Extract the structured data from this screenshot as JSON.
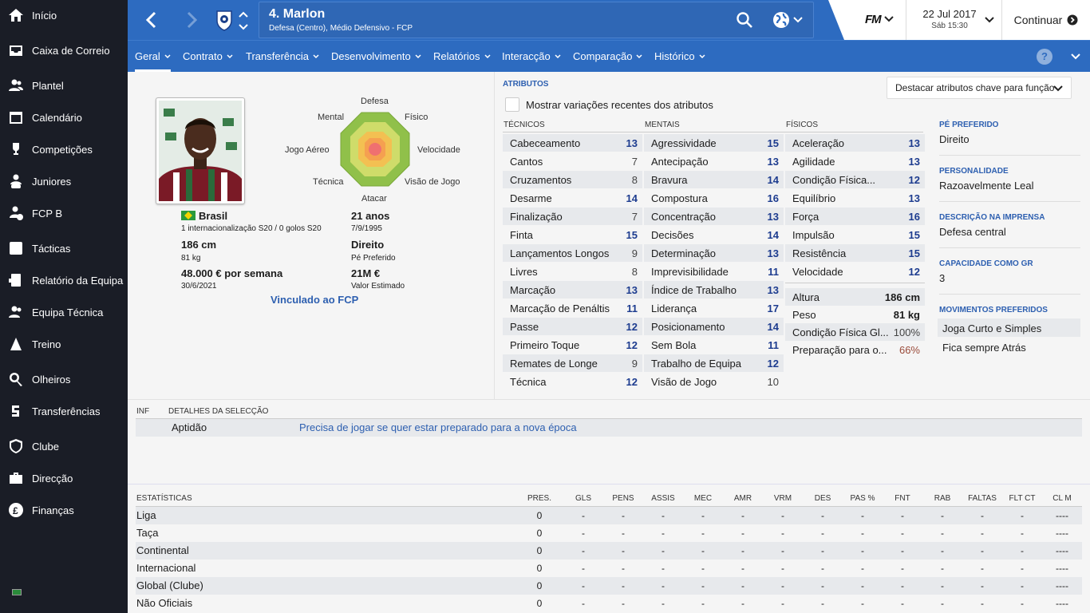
{
  "sidebar": {
    "items": [
      {
        "label": "Início",
        "icon": "home-icon"
      },
      {
        "label": "Caixa de Correio",
        "icon": "inbox-icon"
      },
      {
        "label": "Plantel",
        "icon": "squad-icon"
      },
      {
        "label": "Calendário",
        "icon": "calendar-icon"
      },
      {
        "label": "Competições",
        "icon": "trophy-icon"
      },
      {
        "label": "Juniores",
        "icon": "juniors-icon"
      },
      {
        "label": "FCP B",
        "icon": "b-team-icon"
      },
      {
        "label": "Tácticas",
        "icon": "tactics-icon"
      },
      {
        "label": "Relatório da Equipa",
        "icon": "report-icon"
      },
      {
        "label": "Equipa Técnica",
        "icon": "staff-icon"
      },
      {
        "label": "Treino",
        "icon": "training-icon"
      },
      {
        "label": "Olheiros",
        "icon": "scouting-icon"
      },
      {
        "label": "Transferências",
        "icon": "transfers-icon"
      },
      {
        "label": "Clube",
        "icon": "club-icon"
      },
      {
        "label": "Direcção",
        "icon": "board-icon"
      },
      {
        "label": "Finanças",
        "icon": "finances-icon"
      }
    ]
  },
  "header": {
    "title": "4. Marlon",
    "subtitle": "Defesa (Centro), Médio Defensivo - FCP",
    "fm_logo": "FM",
    "date": "22 Jul 2017",
    "time": "Sáb 15:30",
    "continue_label": "Continuar"
  },
  "tabs": [
    {
      "label": "Geral"
    },
    {
      "label": "Contrato"
    },
    {
      "label": "Transferência"
    },
    {
      "label": "Desenvolvimento"
    },
    {
      "label": "Relatórios"
    },
    {
      "label": "Interacção"
    },
    {
      "label": "Comparação"
    },
    {
      "label": "Histórico"
    }
  ],
  "player": {
    "nation": "Brasil",
    "caps": "1 internacionalização S20 / 0 golos S20",
    "height": "186 cm",
    "weight": "81 kg",
    "wage": "48.000 € por semana",
    "contract_end": "30/6/2021",
    "age": "21 anos",
    "dob": "7/9/1995",
    "foot": "Direito",
    "foot_label": "Pé Preferido",
    "value": "21M €",
    "value_label": "Valor Estimado",
    "link": "Vinculado ao FCP"
  },
  "radar": {
    "labels": [
      "Defesa",
      "Físico",
      "Velocidade",
      "Visão de Jogo",
      "Atacar",
      "Técnica",
      "Jogo Aéreo",
      "Mental"
    ]
  },
  "attributes": {
    "section": "ATRIBUTOS",
    "toggle_label": "Mostrar variações recentes dos atributos",
    "highlight_label": "Destacar atributos chave para função",
    "tech_head": "TÉCNICOS",
    "mental_head": "MENTAIS",
    "phys_head": "FÍSICOS",
    "technical": [
      {
        "name": "Cabeceamento",
        "value": "13"
      },
      {
        "name": "Cantos",
        "value": "7"
      },
      {
        "name": "Cruzamentos",
        "value": "8"
      },
      {
        "name": "Desarme",
        "value": "14"
      },
      {
        "name": "Finalização",
        "value": "7"
      },
      {
        "name": "Finta",
        "value": "15"
      },
      {
        "name": "Lançamentos Longos",
        "value": "9"
      },
      {
        "name": "Livres",
        "value": "8"
      },
      {
        "name": "Marcação",
        "value": "13"
      },
      {
        "name": "Marcação de Penáltis",
        "value": "11"
      },
      {
        "name": "Passe",
        "value": "12"
      },
      {
        "name": "Primeiro Toque",
        "value": "12"
      },
      {
        "name": "Remates de Longe",
        "value": "9"
      },
      {
        "name": "Técnica",
        "value": "12"
      }
    ],
    "mental": [
      {
        "name": "Agressividade",
        "value": "15"
      },
      {
        "name": "Antecipação",
        "value": "13"
      },
      {
        "name": "Bravura",
        "value": "14"
      },
      {
        "name": "Compostura",
        "value": "16"
      },
      {
        "name": "Concentração",
        "value": "13"
      },
      {
        "name": "Decisões",
        "value": "14"
      },
      {
        "name": "Determinação",
        "value": "13"
      },
      {
        "name": "Imprevisibilidade",
        "value": "11"
      },
      {
        "name": "Índice de Trabalho",
        "value": "13"
      },
      {
        "name": "Liderança",
        "value": "17"
      },
      {
        "name": "Posicionamento",
        "value": "14"
      },
      {
        "name": "Sem Bola",
        "value": "11"
      },
      {
        "name": "Trabalho de Equipa",
        "value": "12"
      },
      {
        "name": "Visão de Jogo",
        "value": "10"
      }
    ],
    "physical": [
      {
        "name": "Aceleração",
        "value": "13"
      },
      {
        "name": "Agilidade",
        "value": "13"
      },
      {
        "name": "Condição Física...",
        "value": "12"
      },
      {
        "name": "Equilíbrio",
        "value": "13"
      },
      {
        "name": "Força",
        "value": "16"
      },
      {
        "name": "Impulsão",
        "value": "15"
      },
      {
        "name": "Resistência",
        "value": "15"
      },
      {
        "name": "Velocidade",
        "value": "12"
      }
    ],
    "extra": [
      {
        "name": "Altura",
        "value": "186 cm"
      },
      {
        "name": "Peso",
        "value": "81 kg"
      },
      {
        "name": "Condição Física Gl...",
        "value": "100%"
      },
      {
        "name": "Preparação para o...",
        "value": "66%"
      }
    ]
  },
  "right": {
    "foot_h": "PÉ PREFERIDO",
    "foot_v": "Direito",
    "pers_h": "PERSONALIDADE",
    "pers_v": "Razoavelmente Leal",
    "press_h": "DESCRIÇÃO NA IMPRENSA",
    "press_v": "Defesa central",
    "gk_h": "CAPACIDADE COMO GR",
    "gk_v": "3",
    "moves_h": "MOVIMENTOS PREFERIDOS",
    "moves": [
      "Joga Curto e Simples",
      "Fica sempre Atrás"
    ]
  },
  "info": {
    "col1": "INF",
    "col2": "DETALHES DA SELECÇÃO",
    "row_label": "Aptidão",
    "row_text": "Precisa de jogar se quer estar preparado para a nova época"
  },
  "stats": {
    "title": "ESTATÍSTICAS",
    "headers": [
      "PRES.",
      "GLS",
      "PENS",
      "ASSIS",
      "MEC",
      "AMR",
      "VRM",
      "DES",
      "PAS %",
      "FNT",
      "RAB",
      "FALTAS",
      "FLT CT",
      "CL M"
    ],
    "rows": [
      {
        "name": "Liga",
        "pres": "0",
        "dash": "-",
        "clm": "----"
      },
      {
        "name": "Taça",
        "pres": "0",
        "dash": "-",
        "clm": "----"
      },
      {
        "name": "Continental",
        "pres": "0",
        "dash": "-",
        "clm": "----"
      },
      {
        "name": "Internacional",
        "pres": "0",
        "dash": "-",
        "clm": "----"
      },
      {
        "name": "Global (Clube)",
        "pres": "0",
        "dash": "-",
        "clm": "----"
      },
      {
        "name": "Não Oficiais",
        "pres": "0",
        "dash": "-",
        "clm": "----"
      }
    ]
  },
  "colors": {
    "brand": "#2d6bc0",
    "sidebar": "#1a1d26",
    "value_high": "#1d3c8f"
  }
}
